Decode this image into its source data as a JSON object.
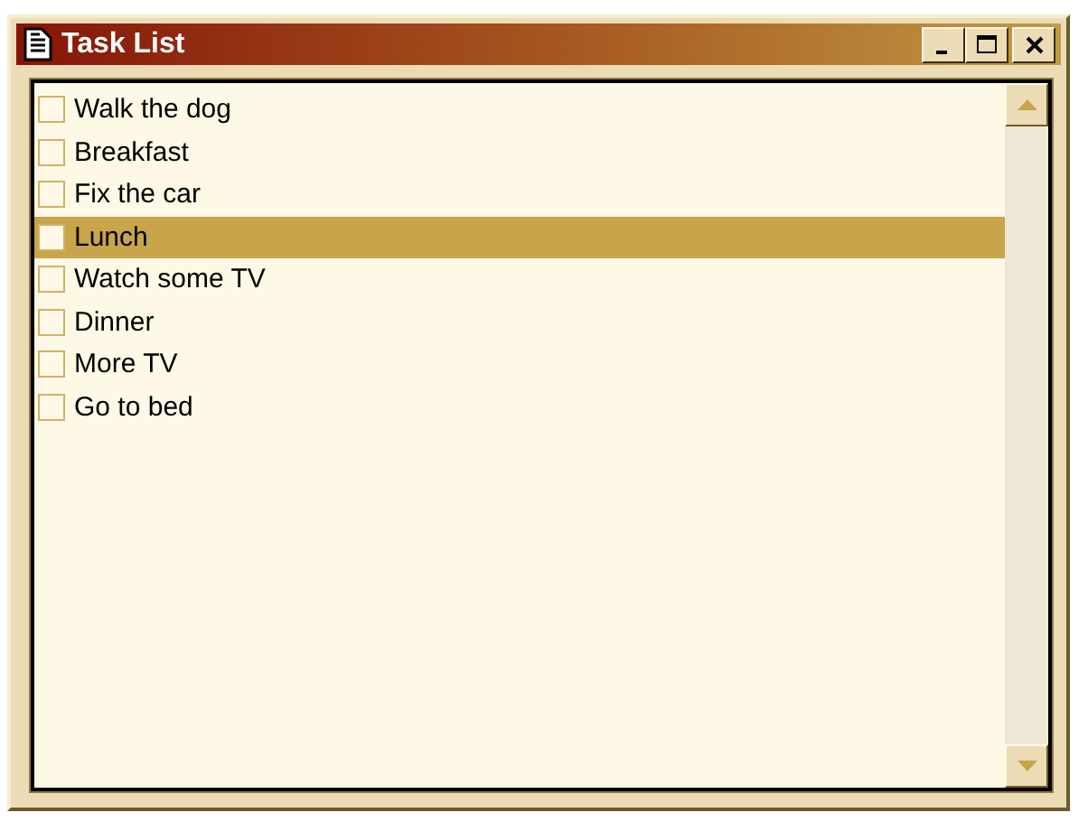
{
  "window": {
    "title": "Task List"
  },
  "tasks": [
    {
      "label": "Walk the dog",
      "checked": false,
      "selected": false
    },
    {
      "label": "Breakfast",
      "checked": false,
      "selected": false
    },
    {
      "label": "Fix the car",
      "checked": false,
      "selected": false
    },
    {
      "label": "Lunch",
      "checked": false,
      "selected": true
    },
    {
      "label": "Watch some TV",
      "checked": false,
      "selected": false
    },
    {
      "label": "Dinner",
      "checked": false,
      "selected": false
    },
    {
      "label": "More TV",
      "checked": false,
      "selected": false
    },
    {
      "label": "Go to bed",
      "checked": false,
      "selected": false
    }
  ]
}
